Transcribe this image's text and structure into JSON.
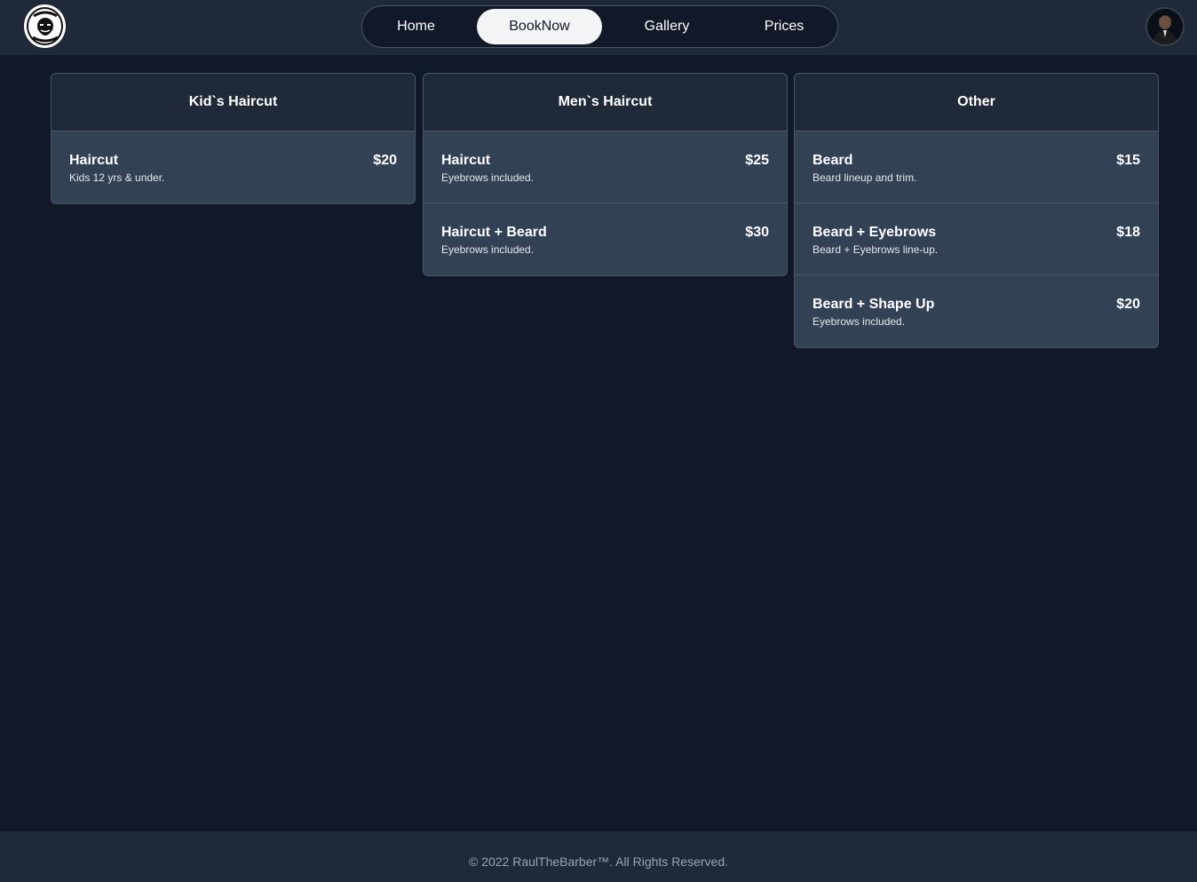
{
  "header": {
    "logo_alt": "Raul The Barber logo",
    "nav": [
      {
        "label": "Home",
        "active": false
      },
      {
        "label": "BookNow",
        "active": true
      },
      {
        "label": "Gallery",
        "active": false
      },
      {
        "label": "Prices",
        "active": false
      }
    ]
  },
  "menus": [
    {
      "title": "Kid`s Haircut",
      "items": [
        {
          "name": "Haircut",
          "desc": "Kids 12 yrs & under.",
          "price": "$20"
        }
      ]
    },
    {
      "title": "Men`s Haircut",
      "items": [
        {
          "name": "Haircut",
          "desc": "Eyebrows included.",
          "price": "$25"
        },
        {
          "name": "Haircut + Beard",
          "desc": "Eyebrows included.",
          "price": "$30"
        }
      ]
    },
    {
      "title": "Other",
      "items": [
        {
          "name": "Beard",
          "desc": "Beard lineup and trim.",
          "price": "$15"
        },
        {
          "name": "Beard + Eyebrows",
          "desc": "Beard + Eyebrows line-up.",
          "price": "$18"
        },
        {
          "name": "Beard + Shape Up",
          "desc": "Eyebrows included.",
          "price": "$20"
        }
      ]
    }
  ],
  "footer": {
    "text": "© 2022 RaulTheBarber™. All Rights Reserved."
  },
  "colors": {
    "background": "#111827",
    "header": "#1f2937",
    "card": "#334155",
    "active_nav": "#f3f4f6"
  }
}
